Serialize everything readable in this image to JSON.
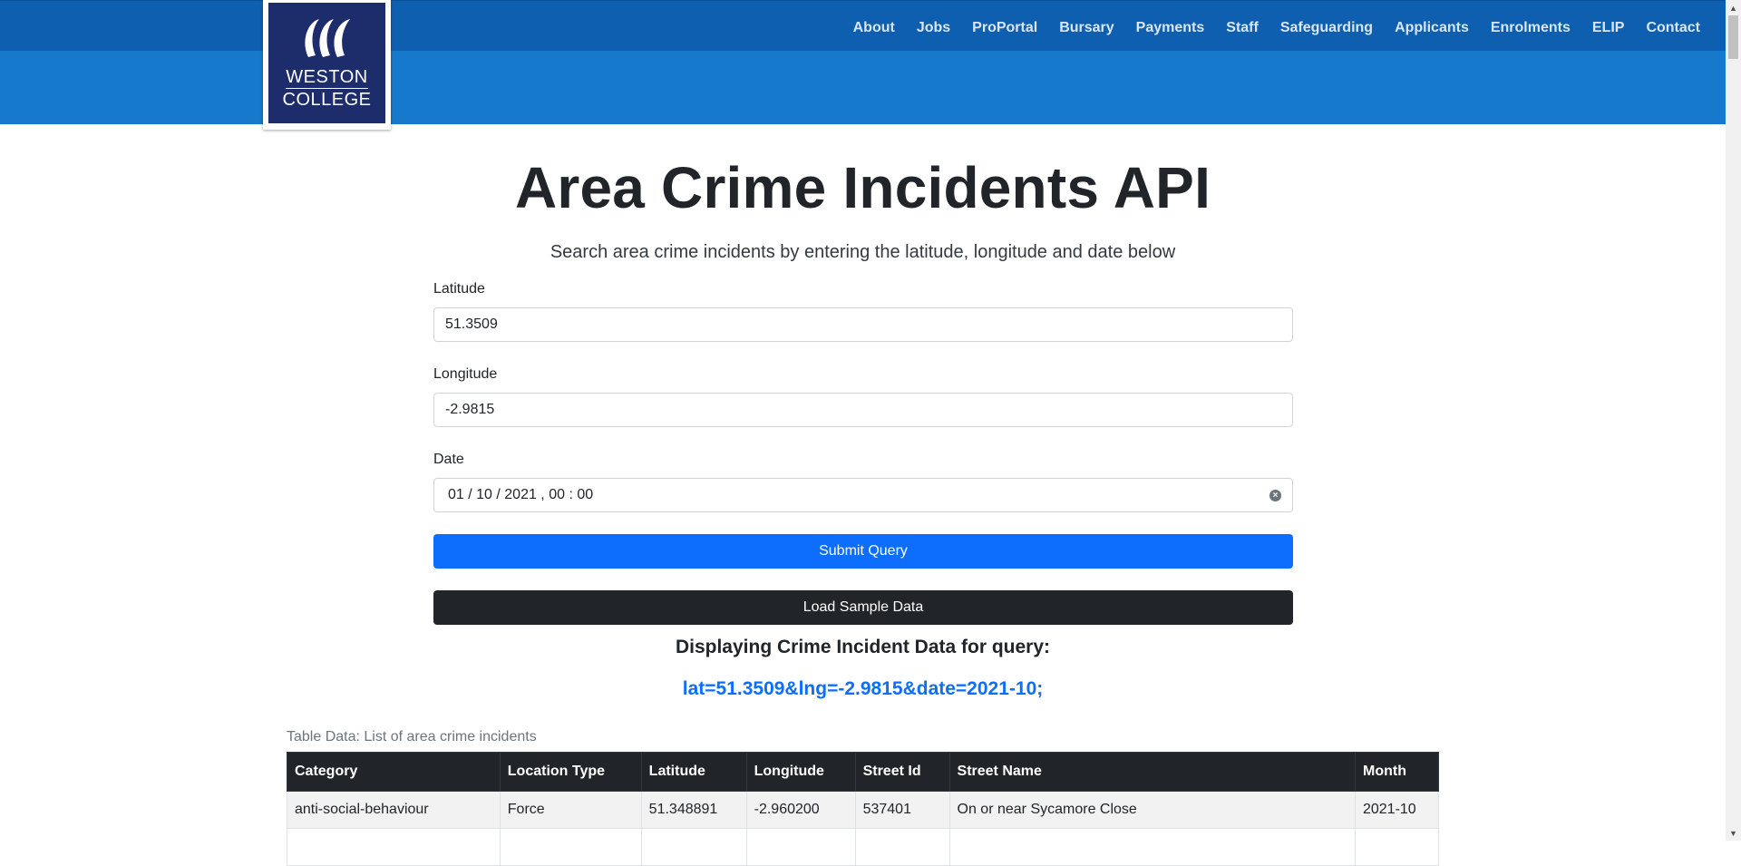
{
  "brand": {
    "logo_line1": "WESTON",
    "logo_line2": "COLLEGE",
    "colors": {
      "header_dark": "#0f5fb0",
      "header_light": "#1779cb",
      "logo_bg": "#1d2d6c"
    }
  },
  "nav": {
    "items": [
      {
        "label": "About"
      },
      {
        "label": "Jobs"
      },
      {
        "label": "ProPortal"
      },
      {
        "label": "Bursary"
      },
      {
        "label": "Payments"
      },
      {
        "label": "Staff"
      },
      {
        "label": "Safeguarding"
      },
      {
        "label": "Applicants"
      },
      {
        "label": "Enrolments"
      },
      {
        "label": "ELIP"
      },
      {
        "label": "Contact"
      }
    ]
  },
  "main": {
    "title": "Area Crime Incidents API",
    "lead": "Search area crime incidents by entering the latitude, longitude and date below",
    "form": {
      "latitude_label": "Latitude",
      "latitude_value": "51.3509",
      "longitude_label": "Longitude",
      "longitude_value": "-2.9815",
      "date_label": "Date",
      "date_value": "01 / 10 / 2021 ,  00 : 00",
      "submit_label": "Submit Query",
      "sample_label": "Load Sample Data"
    },
    "result_heading": "Displaying Crime Incident Data for query:",
    "result_query": "lat=51.3509&lng=-2.9815&date=2021-10;",
    "table": {
      "caption": "Table Data: List of area crime incidents",
      "headers": [
        "Category",
        "Location Type",
        "Latitude",
        "Longitude",
        "Street Id",
        "Street Name",
        "Month"
      ],
      "rows": [
        [
          "anti-social-behaviour",
          "Force",
          "51.348891",
          "-2.960200",
          "537401",
          "On or near Sycamore Close",
          "2021-10"
        ]
      ]
    }
  },
  "colors": {
    "primary": "#0d6efd",
    "dark": "#212529"
  }
}
